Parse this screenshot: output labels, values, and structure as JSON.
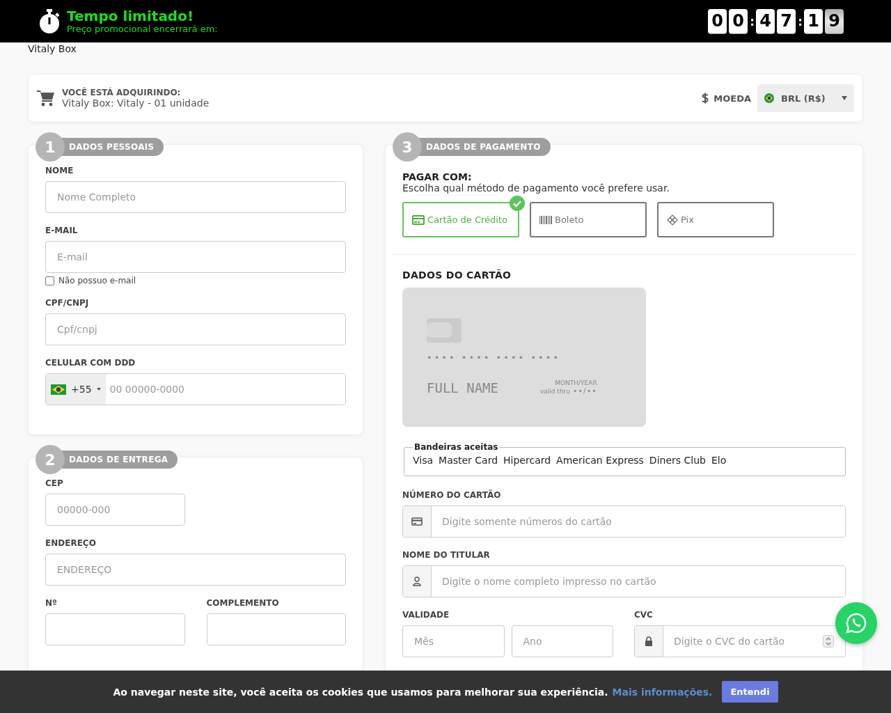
{
  "promo_bar": {
    "title": "Tempo limitado!",
    "subtitle": "Preço promocional encerrará em:",
    "timer": [
      {
        "kind": "digit",
        "text": "0",
        "flipping": false
      },
      {
        "kind": "digit",
        "text": "0",
        "flipping": false
      },
      {
        "kind": "sep",
        "text": ":"
      },
      {
        "kind": "digit",
        "text": "4",
        "flipping": false
      },
      {
        "kind": "digit",
        "text": "7",
        "flipping": false
      },
      {
        "kind": "sep",
        "text": ":"
      },
      {
        "kind": "digit",
        "text": "1",
        "flipping": false
      },
      {
        "kind": "digit",
        "text": "9",
        "flipping": true
      }
    ]
  },
  "store_name": "Vitaly Box",
  "summary": {
    "heading": "VOCÊ ESTÁ ADQUIRINDO:",
    "product": "Vitaly Box: Vitaly - 01 unidade",
    "currency_label": "MOEDA",
    "currency_value": "BRL (R$)"
  },
  "personal": {
    "number": "1",
    "title": "DADOS PESSOAIS",
    "fields": [
      {
        "kind": "text",
        "label": "NOME",
        "placeholder": "Nome Completo"
      },
      {
        "kind": "email",
        "label": "E-MAIL",
        "placeholder": "E-mail",
        "checkbox": {
          "label": "Não possuo e-mail",
          "checked": false
        }
      },
      {
        "kind": "text",
        "label": "CPF/CNPJ",
        "placeholder": "Cpf/cnpj"
      },
      {
        "kind": "phone",
        "label": "CELULAR COM DDD",
        "code": "+55",
        "placeholder": "00 00000-0000"
      }
    ]
  },
  "delivery": {
    "number": "2",
    "title": "DADOS DE ENTREGA",
    "cep": {
      "label": "CEP",
      "placeholder": "00000-000"
    },
    "address": {
      "label": "ENDEREÇO",
      "placeholder": "ENDEREÇO"
    },
    "number_field": {
      "label": "Nº"
    },
    "complement": {
      "label": "COMPLEMENTO"
    }
  },
  "payment": {
    "number": "3",
    "title": "DADOS DE PAGAMENTO",
    "pay_with": "PAGAR COM:",
    "pay_hint": "Escolha qual método de pagamento você prefere usar.",
    "methods": [
      {
        "kind": "card",
        "label": "Cartão de Crédito",
        "selected": true
      },
      {
        "kind": "boleto",
        "label": "Boleto",
        "selected": false
      },
      {
        "kind": "pix",
        "label": "Pix",
        "selected": false
      }
    ],
    "card_heading": "DADOS DO CARTÃO",
    "card_preview": {
      "number": "•••• •••• •••• ••••",
      "name": "FULL NAME",
      "valid_label": "valid thru",
      "month_year_label": "MONTH/YEAR",
      "expiry": "••/••"
    },
    "brands_label": "Bandeiras aceitas",
    "brands": [
      "Visa",
      "Master Card",
      "Hipercard",
      "American Express",
      "Diners Club",
      "Elo"
    ],
    "card_number": {
      "label": "NÚMERO DO CARTÃO",
      "placeholder": "Digite somente números do cartão"
    },
    "holder": {
      "label": "NOME DO TITULAR",
      "placeholder": "Digite o nome completo impresso no cartão"
    },
    "validity": {
      "label": "VALIDADE",
      "month_placeholder": "Mês",
      "year_placeholder": "Ano"
    },
    "cvc": {
      "label": "CVC",
      "placeholder": "Digite o CVC do cartão"
    }
  },
  "cookie_bar": {
    "text": "Ao navegar neste site, você aceita os cookies que usamos para melhorar sua experiência.",
    "link": "Mais informações.",
    "button": "Entendi"
  }
}
